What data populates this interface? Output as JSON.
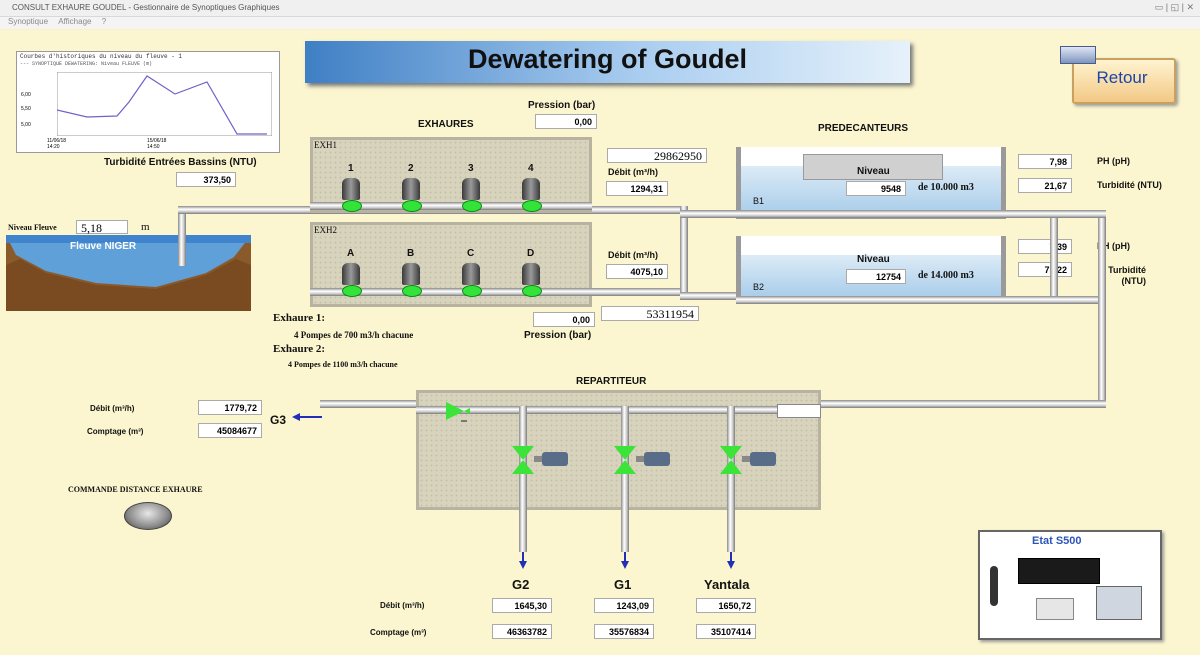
{
  "window": {
    "title": "CONSULT EXHAURE GOUDEL - Gestionnaire de Synoptiques Graphiques",
    "controls": "▭ | ◱ | ✕"
  },
  "menu": {
    "items": [
      "Synoptique",
      "Affichage",
      "?"
    ]
  },
  "header": {
    "title": "Dewatering of Goudel",
    "retour": "Retour"
  },
  "trend": {
    "title": "Courbes d'historiques du niveau du fleuve - 1",
    "legend": "--- SYNOPTIQUE DEWATERING: Niveau FLEUVE (m)",
    "y_ticks": [
      "6,00",
      "5,50",
      "5,00"
    ],
    "x_ticks": [
      "11/06/18\n14:20",
      "15/06/18\n14:50"
    ]
  },
  "turbidite_entrees": {
    "label": "Turbidité Entrées Bassins (NTU)",
    "value": "373,50"
  },
  "fleuve": {
    "niveau_label": "Niveau Fleuve",
    "niveau_value": "5,18",
    "unit": "m",
    "name": "Fleuve NIGER"
  },
  "exhaures": {
    "title": "EXHAURES",
    "pression_top_label": "Pression (bar)",
    "pression_top_value": "0,00",
    "pression_bottom_label": "Pression (bar)",
    "pression_bottom_value": "0,00",
    "exh1": {
      "name": "EXH1",
      "pumps": [
        "1",
        "2",
        "3",
        "4"
      ],
      "debit_label": "Débit (m³/h)",
      "debit_value": "1294,31",
      "counter": "29862950"
    },
    "exh2": {
      "name": "EXH2",
      "pumps": [
        "A",
        "B",
        "C",
        "D"
      ],
      "debit_label": "Débit (m³/h)",
      "debit_value": "4075,10",
      "counter": "53311954"
    },
    "notes": {
      "exh1_title": "Exhaure 1:",
      "exh1_desc": "4 Pompes de 700 m3/h chacune",
      "exh2_title": "Exhaure 2:",
      "exh2_desc": "4 Pompes de 1100 m3/h chacune"
    }
  },
  "predecanteurs": {
    "title": "PREDECANTEURS",
    "b1": {
      "name": "B1",
      "niveau_label": "Niveau",
      "niveau_value": "9548",
      "capacity": "de 10.000 m3",
      "ph_value": "7,98",
      "ph_label": "PH (pH)",
      "turb_value": "21,67",
      "turb_label": "Turbidité (NTU)"
    },
    "b2": {
      "name": "B2",
      "niveau_label": "Niveau",
      "niveau_value": "12754",
      "capacity": "de 14.000 m3",
      "ph_value": "7,39",
      "ph_label": "PH (pH)",
      "turb_value": "75,22",
      "turb_label": "Turbidité (NTU)"
    }
  },
  "repartiteur": {
    "title": "REPARTITEUR",
    "g3": {
      "name": "G3",
      "debit_label": "Débit (m³/h)",
      "debit_value": "1779,72",
      "comptage_label": "Comptage (m³)",
      "comptage_value": "45084677"
    },
    "outlets": [
      {
        "name": "G2",
        "debit": "1645,30",
        "comptage": "46363782"
      },
      {
        "name": "G1",
        "debit": "1243,09",
        "comptage": "35576834"
      },
      {
        "name": "Yantala",
        "debit": "1650,72",
        "comptage": "35107414"
      }
    ],
    "debit_label": "Débit (m³/h)",
    "comptage_label": "Comptage (m³)"
  },
  "commande": {
    "label": "COMMANDE DISTANCE EXHAURE"
  },
  "etat": {
    "title": "Etat S500"
  },
  "colors": {
    "pump_led": "#34e33a",
    "title_band": "#6fa6da",
    "arrow": "#1f2fb8"
  }
}
